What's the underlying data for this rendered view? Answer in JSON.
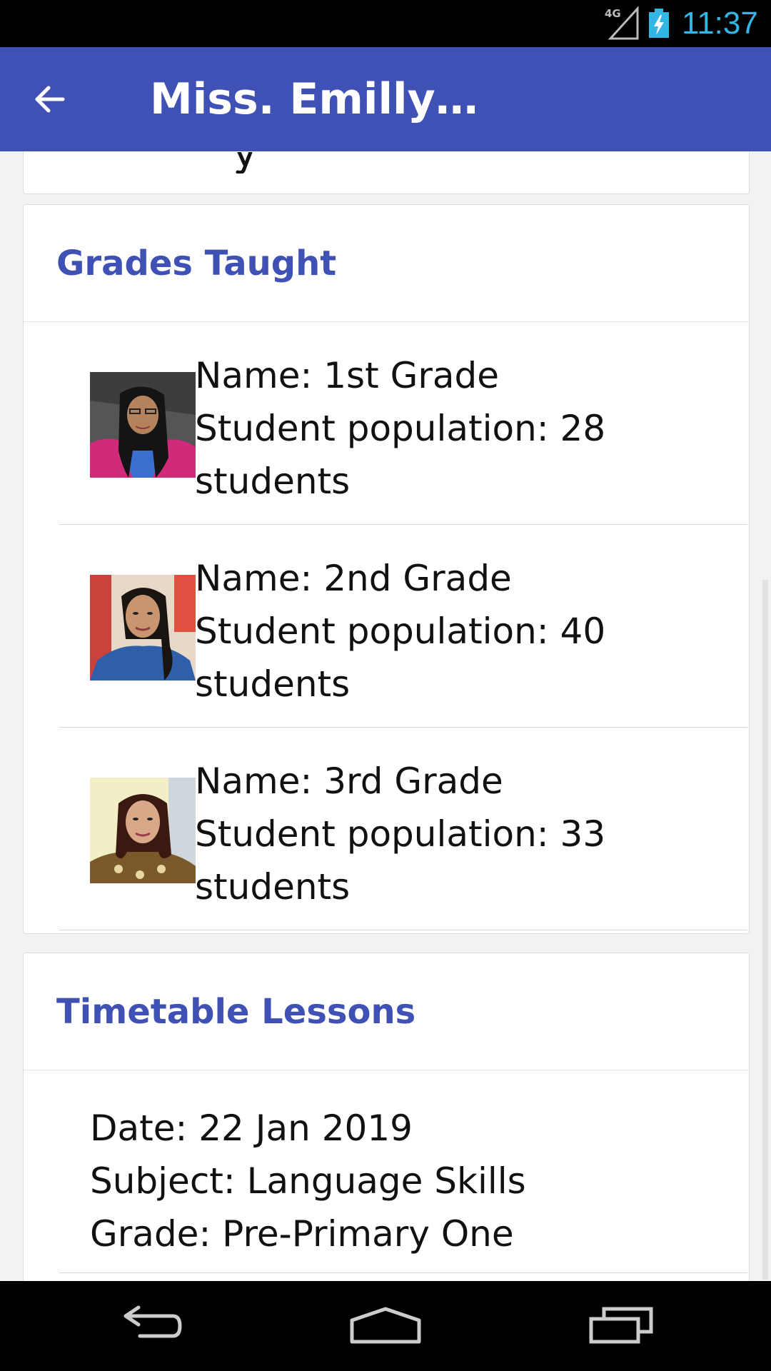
{
  "status_bar": {
    "network": "4G",
    "time": "11:37",
    "clock_color": "#33b5e5"
  },
  "app_bar": {
    "title": "Miss. Emilly…",
    "back_icon": "arrow-back-icon",
    "color": "#3f51b5"
  },
  "sections": {
    "grades": {
      "title": "Grades Taught",
      "items": [
        {
          "name": "Name: 1st Grade",
          "population_line": "Student population: 28",
          "unit_line": "students",
          "avatar": "teacher-photo-1"
        },
        {
          "name": "Name: 2nd Grade",
          "population_line": "Student population: 40",
          "unit_line": "students",
          "avatar": "teacher-photo-2"
        },
        {
          "name": "Name: 3rd Grade",
          "population_line": "Student population: 33",
          "unit_line": "students",
          "avatar": "teacher-photo-3"
        }
      ]
    },
    "timetable": {
      "title": "Timetable Lessons",
      "items": [
        {
          "date": "Date: 22 Jan 2019",
          "subject": "Subject: Language Skills",
          "grade": "Grade: Pre-Primary One"
        }
      ]
    }
  },
  "nav_bar": {
    "back_icon": "nav-back-icon",
    "home_icon": "nav-home-icon",
    "recents_icon": "nav-recents-icon"
  }
}
